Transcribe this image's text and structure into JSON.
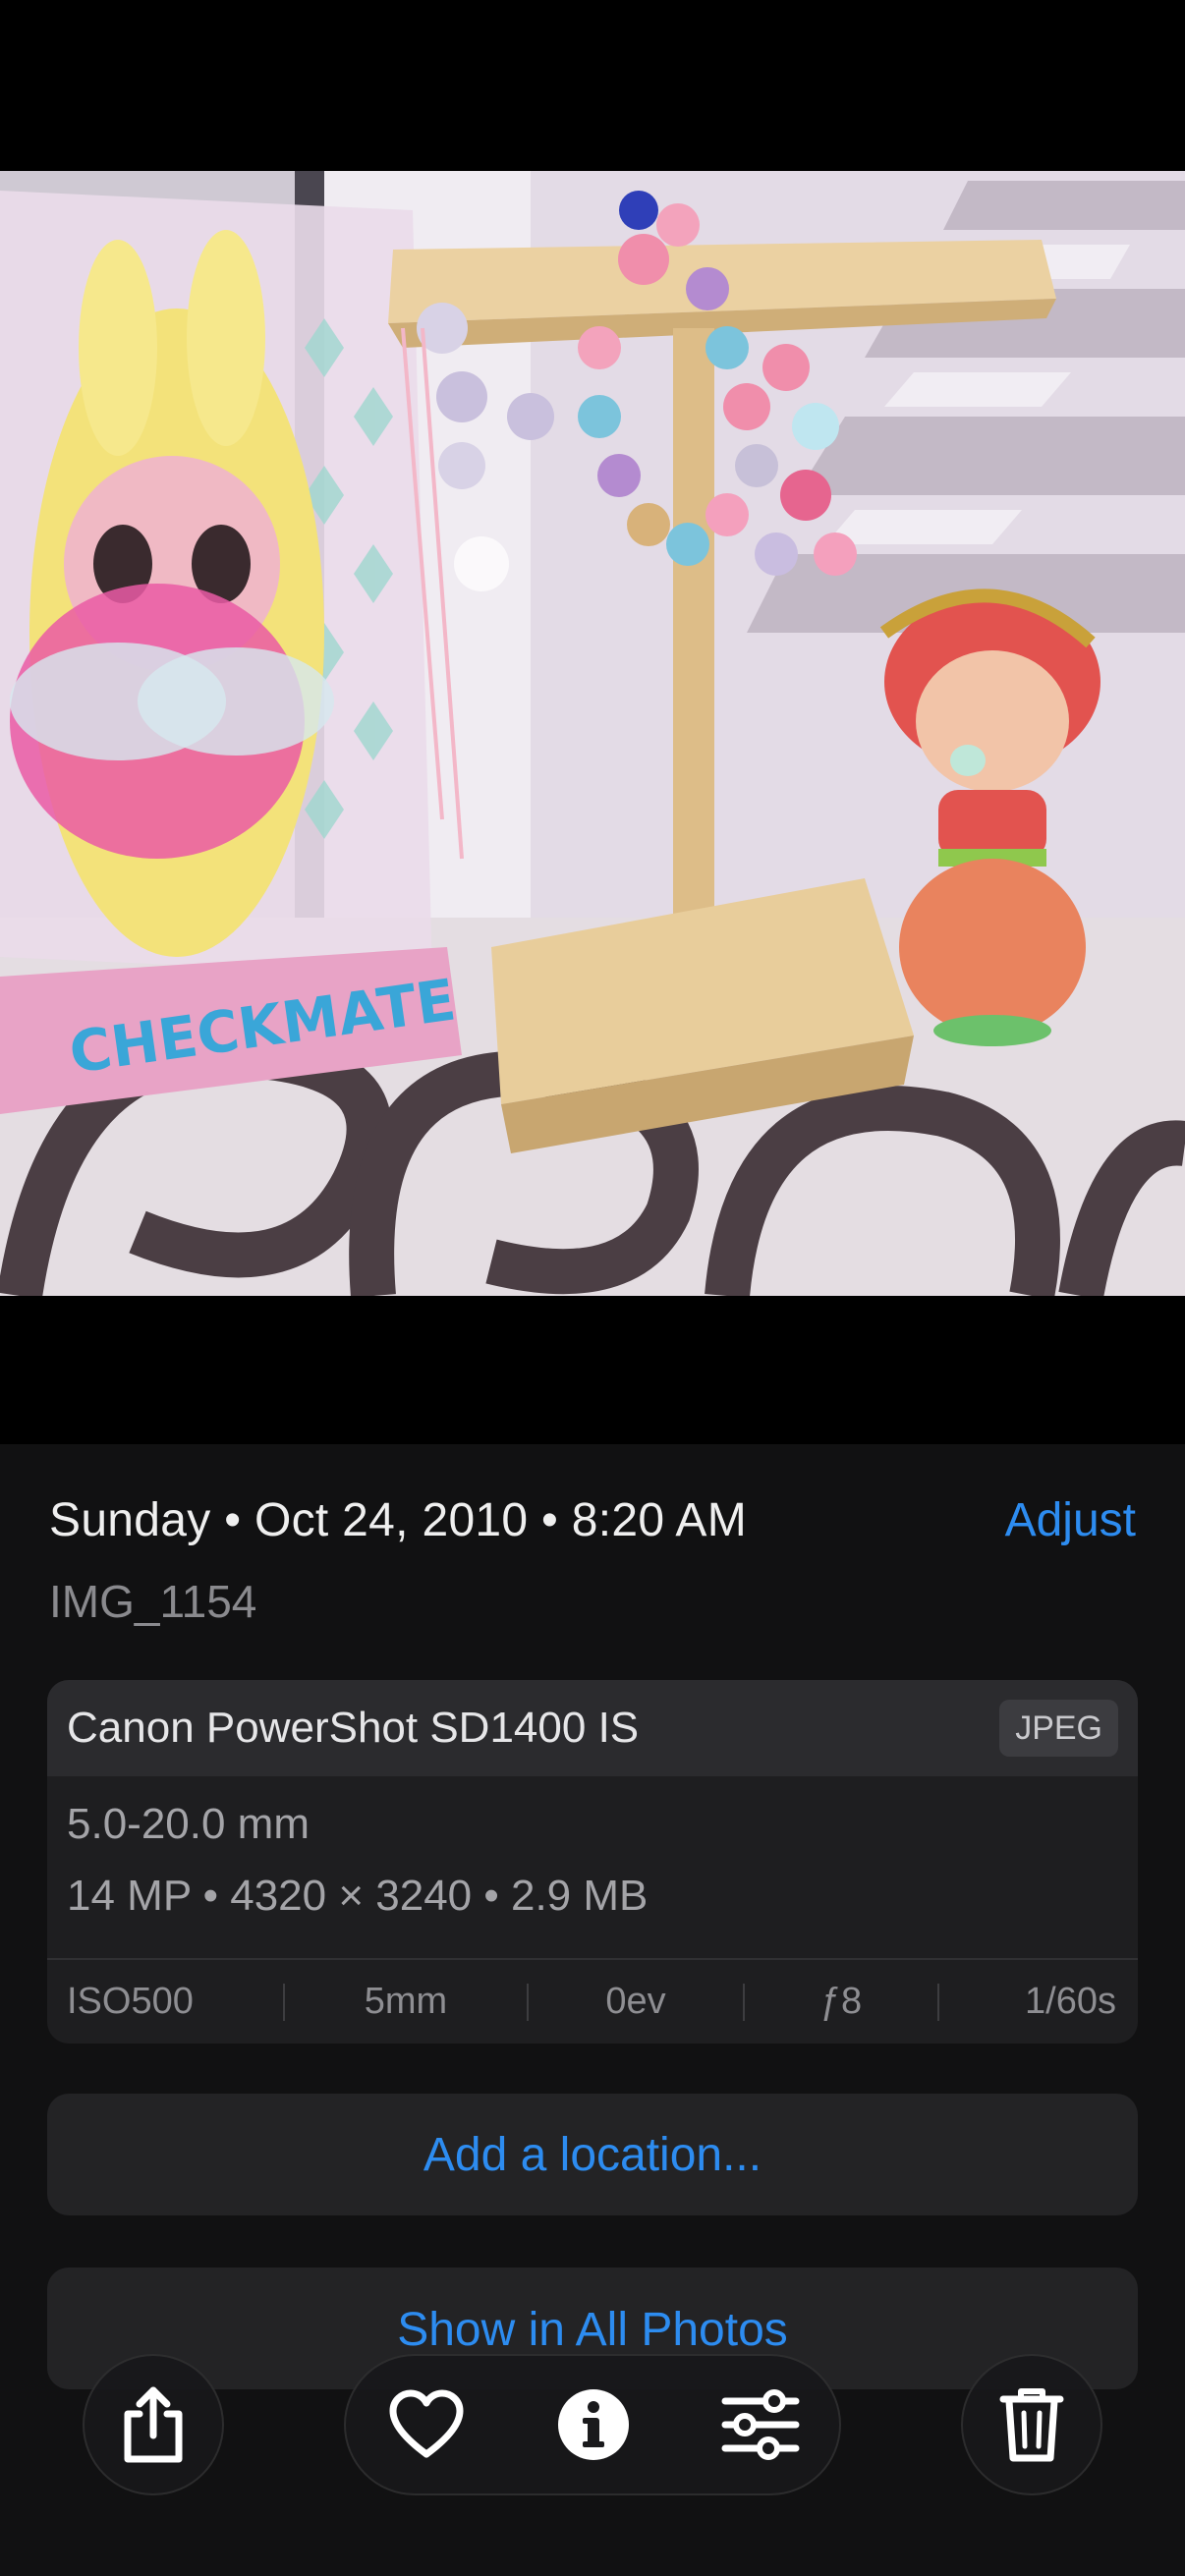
{
  "photo": {
    "box_label": "CHECKMATE"
  },
  "info": {
    "date_time": "Sunday • Oct 24, 2010 • 8:20 AM",
    "adjust_label": "Adjust",
    "filename": "IMG_1154"
  },
  "exif": {
    "camera": "Canon PowerShot SD1400 IS",
    "format": "JPEG",
    "lens": "5.0-20.0 mm",
    "specs": "14 MP • 4320 × 3240 • 2.9 MB",
    "iso": "ISO500",
    "focal_length": "5mm",
    "exposure_value": "0ev",
    "aperture": "ƒ8",
    "shutter": "1/60s"
  },
  "actions": {
    "add_location": "Add a location...",
    "show_all_photos": "Show in All Photos"
  },
  "toolbar": {
    "share": "share-icon",
    "favorite": "heart-icon",
    "info": "info-icon",
    "edit": "sliders-icon",
    "delete": "trash-icon"
  },
  "colors": {
    "accent": "#2d8cf0",
    "background": "#000000",
    "sheet": "#111112"
  }
}
